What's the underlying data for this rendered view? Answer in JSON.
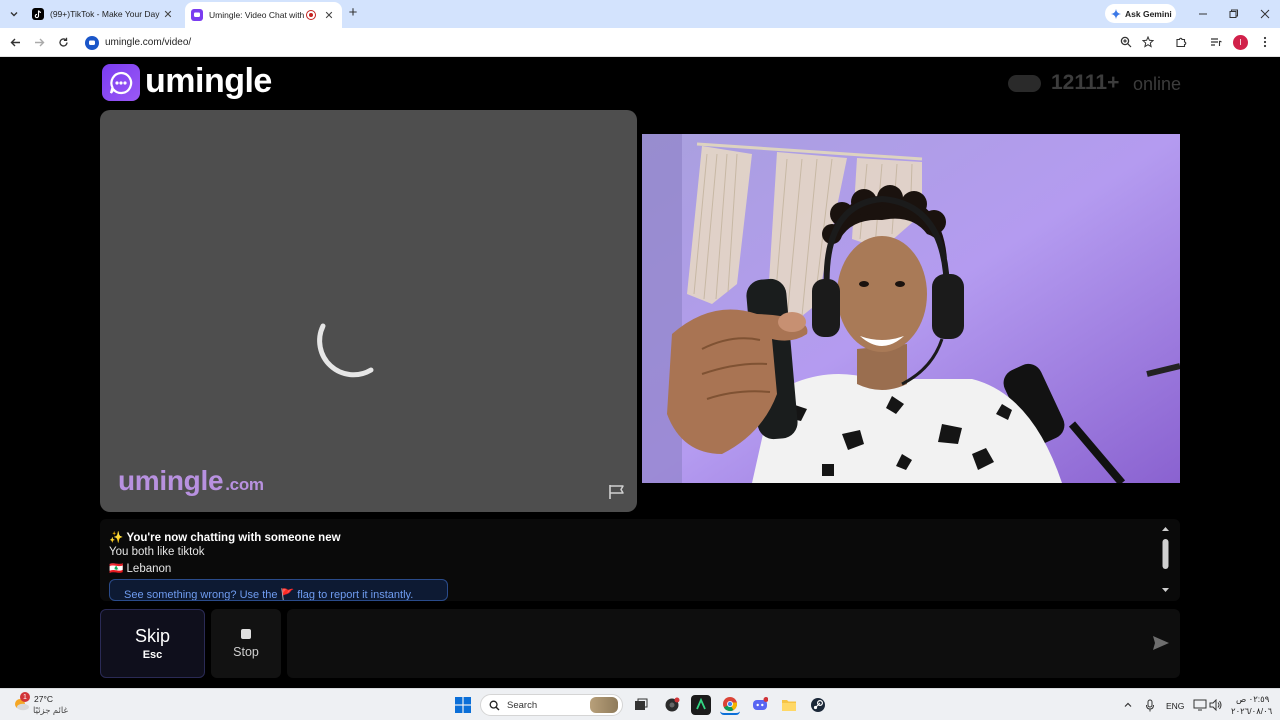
{
  "browser": {
    "tabs": [
      {
        "title": "(99+)TikTok - Make Your Day"
      },
      {
        "title": "Umingle: Video Chat with Str"
      }
    ],
    "ask_gemini": "Ask Gemini",
    "url": "umingle.com/video/",
    "profile_initial": "I"
  },
  "site": {
    "logo": "umingle",
    "online_count": "12111+",
    "online_label": "online",
    "watermark": "umingle",
    "watermark_suffix": ".com"
  },
  "chat": {
    "status_icon": "✨",
    "status": "You're now chatting with someone new",
    "interests": "You both like tiktok",
    "flag_icon": "🇱🇧",
    "country": "Lebanon",
    "report_banner": "See something wrong? Use the 🚩 flag to report it instantly."
  },
  "controls": {
    "skip_label": "Skip",
    "skip_hint": "Esc",
    "stop_label": "Stop",
    "message_placeholder": ""
  },
  "taskbar": {
    "notification_count": "1",
    "temperature": "27°C",
    "weather_desc": "غائم جزئيًا",
    "search_label": "Search",
    "language": "ENG",
    "time": "٠٢:٥٩ ص",
    "date": "٢٠٢٦/٠٨/٠٦"
  },
  "colors": {
    "brand": "#8a4af3",
    "page_bg": "#000000",
    "video_placeholder": "#4e4e4e",
    "tab_strip": "#d3e3fd"
  }
}
